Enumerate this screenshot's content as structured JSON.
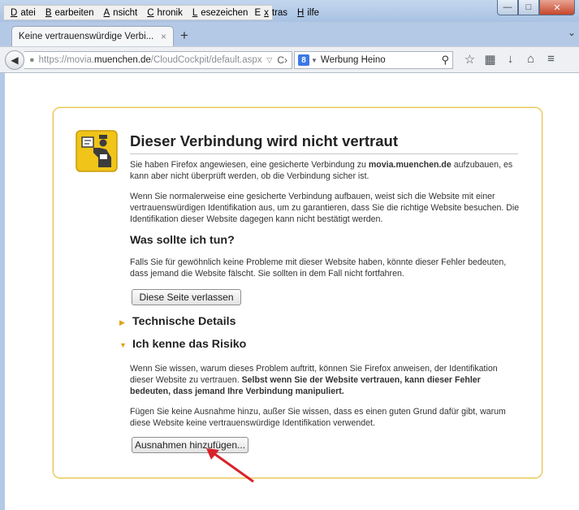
{
  "menu": {
    "datei": "Datei",
    "bearbeiten": "Bearbeiten",
    "ansicht": "Ansicht",
    "chronik": "Chronik",
    "lesezeichen": "Lesezeichen",
    "extras": "Extras",
    "hilfe": "Hilfe"
  },
  "tab": {
    "title": "Keine vertrauenswürdige Verbi...",
    "close": "×",
    "new_tab": "+"
  },
  "urlbar": {
    "prefix": "https://movia.",
    "domain": "muenchen.de",
    "path": "/CloudCockpit/default.aspx"
  },
  "search": {
    "engine": "8",
    "query": "Werbung Heino"
  },
  "page": {
    "title": "Dieser Verbindung wird nicht vertraut",
    "intro_part1": "Sie haben Firefox angewiesen, eine gesicherte Verbindung zu ",
    "intro_domain": "movia.muenchen.de",
    "intro_part2": " aufzubauen, es kann aber nicht überprüft werden, ob die Verbindung sicher ist.",
    "explain": "Wenn Sie normalerweise eine gesicherte Verbindung aufbauen, weist sich die Website mit einer vertrauenswürdigen Identifikation aus, um zu garantieren, dass Sie die richtige Website besuchen. Die Identifikation dieser Website dagegen kann nicht bestätigt werden.",
    "what_heading": "Was sollte ich tun?",
    "what_text": "Falls Sie für gewöhnlich keine Probleme mit dieser Website haben, könnte dieser Fehler bedeuten, dass jemand die Website fälscht. Sie sollten in dem Fall nicht fortfahren.",
    "leave_button": "Diese Seite verlassen",
    "tech_heading": "Technische Details",
    "risk_heading": "Ich kenne das Risiko",
    "risk_text1": "Wenn Sie wissen, warum dieses Problem auftritt, können Sie Firefox anweisen, der Identifikation dieser Website zu vertrauen. ",
    "risk_text1_bold": "Selbst wenn Sie der Website vertrauen, kann dieser Fehler bedeuten, dass jemand Ihre Verbindung manipuliert.",
    "risk_text2": "Fügen Sie keine Ausnahme hinzu, außer Sie wissen, dass es einen guten Grund dafür gibt, warum diese Website keine vertrauenswürdige Identifikation verwendet.",
    "add_exception_button": "Ausnahmen hinzufügen..."
  },
  "colors": {
    "panel_border": "#e6c24c",
    "arrow": "#d8232a",
    "tab_strip": "#b4c9e6"
  }
}
